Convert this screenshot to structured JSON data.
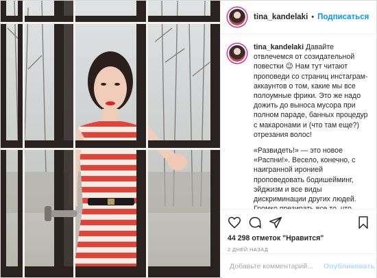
{
  "post": {
    "username": "tina_kandelaki",
    "follow_label": "Подписаться",
    "separator": "•",
    "more_icon": "more-horizontal-icon",
    "caption_p1": "Давайте отвлечемся от созидательной повестки 😉 Нам тут читают проповеди со страниц инстаграм-аккаунтов о том, какие мы все полоумные фрики. Это же надо дожить до выноса мусора при полном параде, банных процедур с макаронами и (что там еще?) отрезания волос!",
    "caption_p2": "«Развидеть!» — это новое «Распни!». Весело, конечно, с наигранной иронией проповедовать бодишейминг, эйджизм и все виды дискриминации других людей. Громко презирать все то, что придумано человечеством с единственной целью: чтобы кончилась уже ненависть. И все это отражено в Библии...",
    "likes": "44 298 отметок \"Нравится\"",
    "time": "2 ДНЕЙ НАЗАД",
    "comment_placeholder": "Добавьте комментарий...",
    "publish_label": "Опубликовать"
  },
  "icons": [
    "heart-icon",
    "comment-icon",
    "share-icon",
    "bookmark-icon"
  ],
  "colors": {
    "accent": "#0095f6",
    "publish_disabled": "#b3dbff",
    "dress_red": "#e4433a",
    "frame": "#2a2220"
  }
}
